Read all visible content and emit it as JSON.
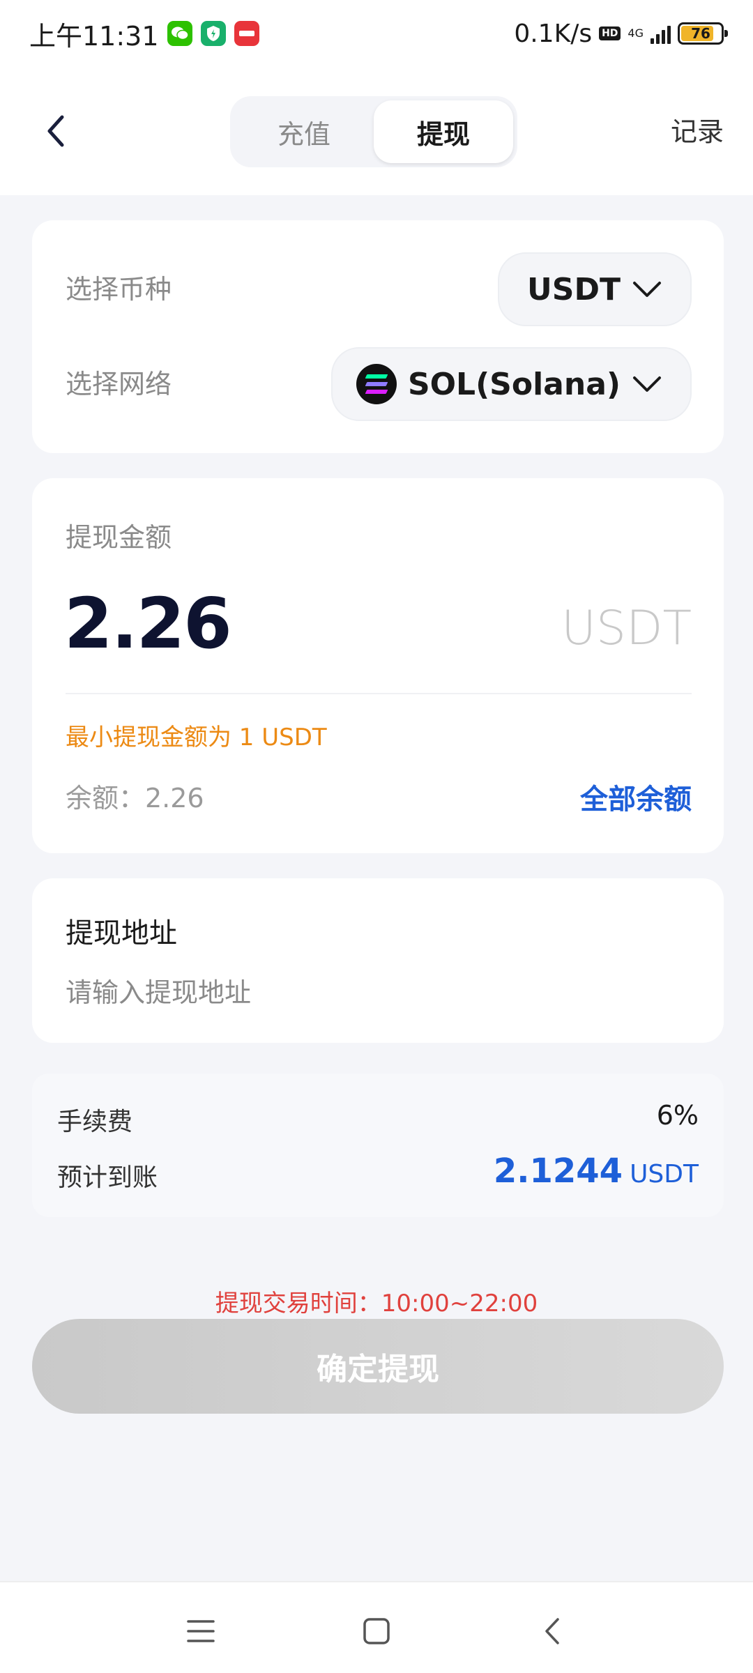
{
  "status_bar": {
    "time": "上午11:31",
    "net_speed": "0.1K/s",
    "hd": "HD",
    "network": "4G",
    "battery": "76"
  },
  "header": {
    "tabs": [
      {
        "label": "充值",
        "active": false
      },
      {
        "label": "提现",
        "active": true
      }
    ],
    "records_label": "记录"
  },
  "selection": {
    "coin_label": "选择币种",
    "coin_value": "USDT",
    "network_label": "选择网络",
    "network_value": "SOL(Solana)"
  },
  "amount": {
    "title": "提现金额",
    "value": "2.26",
    "unit": "USDT",
    "min_hint": "最小提现金额为 1 USDT",
    "balance": "余额：2.26",
    "all_balance": "全部余额"
  },
  "address": {
    "title": "提现地址",
    "placeholder": "请输入提现地址"
  },
  "fee": {
    "fee_label": "手续费",
    "fee_value": "6%",
    "expected_label": "预计到账",
    "expected_value": "2.1244",
    "expected_unit": "USDT"
  },
  "footer": {
    "trade_time": "提现交易时间：10:00~22:00",
    "confirm_label": "确定提现"
  },
  "colors": {
    "accent_blue": "#1e5fd8",
    "warning_orange": "#ec8a14",
    "alert_red": "#e0413d"
  }
}
